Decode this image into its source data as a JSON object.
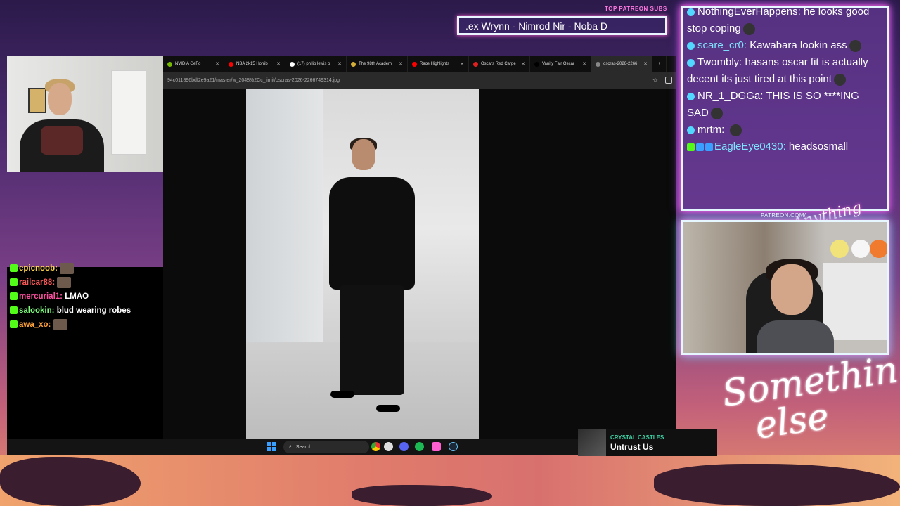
{
  "browser": {
    "tabs": [
      {
        "label": "NVIDIA GeFo",
        "fav": "#76b900"
      },
      {
        "label": "NBA 2k15 Horrib",
        "fav": "#ff0000"
      },
      {
        "label": "(17) philip lewis o",
        "fav": "#ffffff"
      },
      {
        "label": "The 98th Academ",
        "fav": "#d4af37"
      },
      {
        "label": "Race Highlights |",
        "fav": "#ff0000"
      },
      {
        "label": "Oscars Red Carpe",
        "fav": "#e02020"
      },
      {
        "label": "Vanity Fair Oscar",
        "fav": "#000000"
      },
      {
        "label": "oscras-2026-2266",
        "fav": "#888888"
      }
    ],
    "url": "94c011896bdf2e9a21/master/w_2048%2Cc_limit/oscras-2026-2266749314.jpg",
    "new_tab": "+"
  },
  "taskbar": {
    "search_placeholder": "Search"
  },
  "now_playing": {
    "artist": "CRYSTAL CASTLES",
    "song": "Untrust Us"
  },
  "top_subs": {
    "label": "TOP PATREON SUBS",
    "names": ".ex Wrynn - Nimrod Nir - Noba D"
  },
  "chat_right": [
    {
      "user": "NothingEverHappens:",
      "text": "he looks good stop coping"
    },
    {
      "user": "scare_cr0:",
      "text": "Kawabara lookin ass"
    },
    {
      "user": "Twombly:",
      "text": "hasans oscar fit is actually decent its just tired at this point"
    },
    {
      "user": "NR_1_DGGa:",
      "text": "THIS IS SO ****ING SAD"
    },
    {
      "user": "mrtm:",
      "text": ""
    },
    {
      "user": "EagleEye0430:",
      "text": "headsosmall"
    }
  ],
  "chat_left": [
    {
      "user": "epicnoob:",
      "text": "",
      "color": "#ffd54a"
    },
    {
      "user": "railcar88:",
      "text": "",
      "color": "#ff5a5a"
    },
    {
      "user": "mercurial1:",
      "text": "LMAO",
      "color": "#ff4fa0"
    },
    {
      "user": "salookin:",
      "text": "blud wearing robes",
      "color": "#7cfc7c"
    },
    {
      "user": "awa_xo:",
      "text": "",
      "color": "#ffa23a"
    }
  ],
  "branding": {
    "patreon_url": "PATREON.COM/",
    "script_small": "Anything else?",
    "script_big_line1": "Something",
    "script_big_line2": "else"
  },
  "colors": {
    "neon_border": "#e6f7ff",
    "neon_pink": "#ff5fd1",
    "kick_green": "#53fc18",
    "artist_green": "#3ecfa3"
  }
}
